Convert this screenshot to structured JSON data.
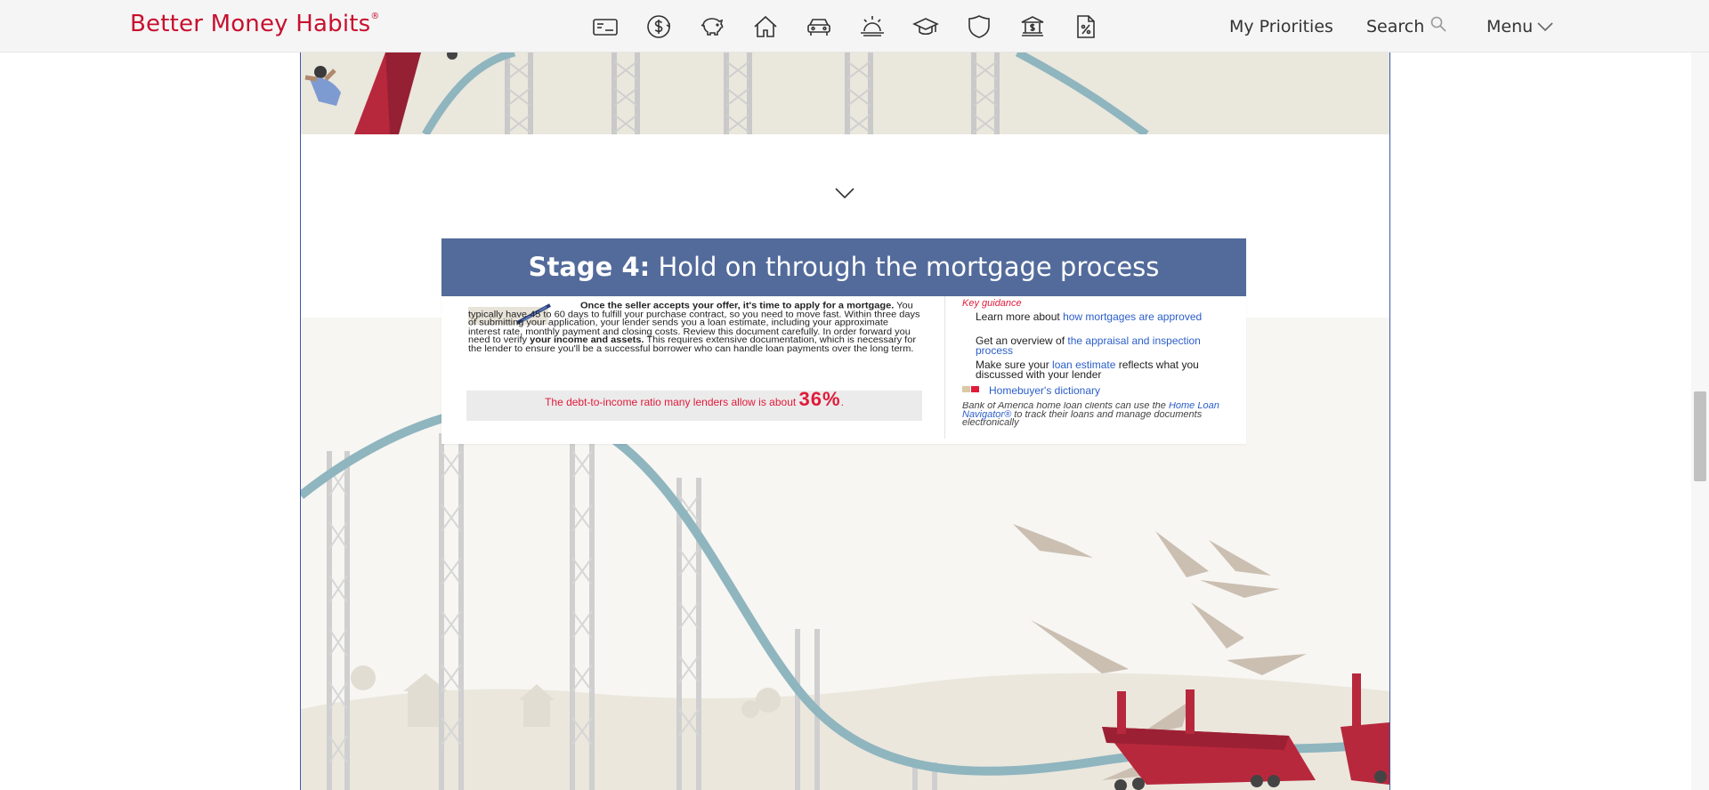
{
  "header": {
    "brand": "Better Money Habits",
    "brand_mark": "®",
    "nav_icons": [
      "credit-card-icon",
      "dollar-cycle-icon",
      "piggy-bank-icon",
      "home-icon",
      "car-icon",
      "sunrise-icon",
      "graduation-cap-icon",
      "shield-icon",
      "bank-icon",
      "percent-document-icon"
    ],
    "links": {
      "priorities": "My Priorities",
      "search": "Search",
      "menu": "Menu"
    }
  },
  "stage": {
    "number_label": "Stage 4:",
    "title": "Hold on through the mortgage process",
    "lead_bold": "Once the seller accepts your offer, it's time to apply for a mortgage.",
    "lead_text": "You typically have 45 to 60 days to fulfill your purchase contract, so you need to move fast. Within three days of submitting your application, your lender sends you a loan estimate, including your approximate interest rate, monthly payment and closing costs. Review this document carefully. In order forward you need to verify",
    "assets_bold": "your income and assets.",
    "assets_text": "This requires extensive documentation, which is necessary for the lender to ensure you'll be a successful borrower who can handle loan payments over the long term.",
    "ratio_text": "The debt-to-income ratio many lenders allow is about",
    "ratio_value": "36%",
    "key_title": "Key guidance",
    "guidance": [
      {
        "text": "Learn more about",
        "link": "how mortgages are approved"
      },
      {
        "text": "Get an overview of",
        "link": "the appraisal and inspection process"
      },
      {
        "text": "Make sure your",
        "link": "loan estimate",
        "tail": "reflects what you discussed with your lender"
      }
    ],
    "dictionary_link": "Homebuyer's dictionary",
    "note_text": "Bank of America home loan clients can use the",
    "note_link": "Home Loan Navigator®",
    "note_tail": "to track their loans and manage documents electronically"
  },
  "colors": {
    "brand_red": "#c8102e",
    "stage_header": "#536b9b",
    "link_blue": "#2b5ec9",
    "accent_red": "#e01a3a",
    "coaster_red": "#b8283c",
    "track_teal": "#8fb5bf"
  }
}
